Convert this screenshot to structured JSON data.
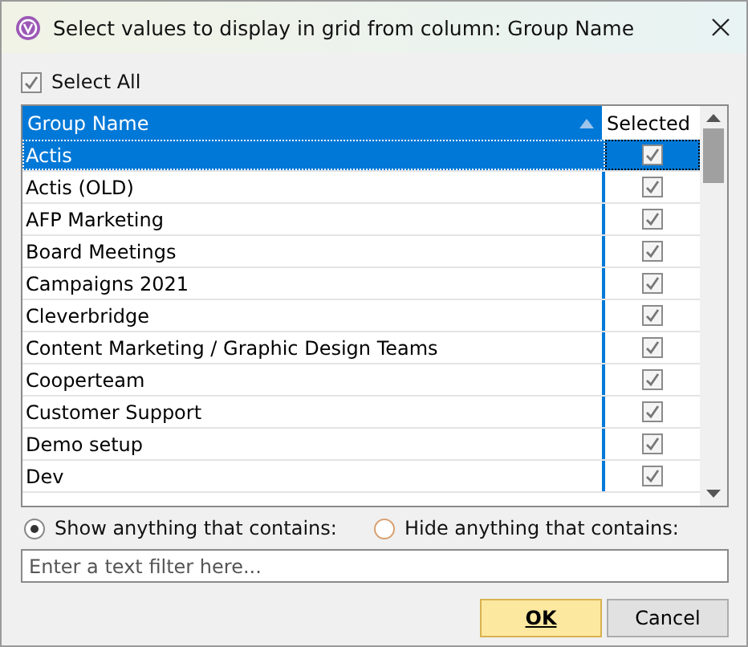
{
  "window": {
    "title": "Select values to display in grid from column: Group Name"
  },
  "select_all": {
    "label": "Select All",
    "checked": true
  },
  "table": {
    "columns": [
      "Group Name",
      "Selected"
    ],
    "rows": [
      {
        "name": "Actis",
        "checked": true,
        "selected": true
      },
      {
        "name": "Actis (OLD)",
        "checked": true,
        "selected": false
      },
      {
        "name": "AFP Marketing",
        "checked": true,
        "selected": false
      },
      {
        "name": "Board Meetings",
        "checked": true,
        "selected": false
      },
      {
        "name": "Campaigns 2021",
        "checked": true,
        "selected": false
      },
      {
        "name": "Cleverbridge",
        "checked": true,
        "selected": false
      },
      {
        "name": "Content Marketing / Graphic Design Teams",
        "checked": true,
        "selected": false
      },
      {
        "name": "Cooperteam",
        "checked": true,
        "selected": false
      },
      {
        "name": "Customer Support",
        "checked": true,
        "selected": false
      },
      {
        "name": "Demo setup",
        "checked": true,
        "selected": false
      },
      {
        "name": "Dev",
        "checked": true,
        "selected": false
      }
    ]
  },
  "filter_modes": [
    {
      "label": "Show anything that contains:",
      "selected": true
    },
    {
      "label": "Hide anything that contains:",
      "selected": false
    }
  ],
  "filter": {
    "placeholder": "Enter a text filter here..."
  },
  "buttons": [
    {
      "label": "OK",
      "kind": "primary"
    },
    {
      "label": "Cancel",
      "kind": "secondary"
    }
  ]
}
